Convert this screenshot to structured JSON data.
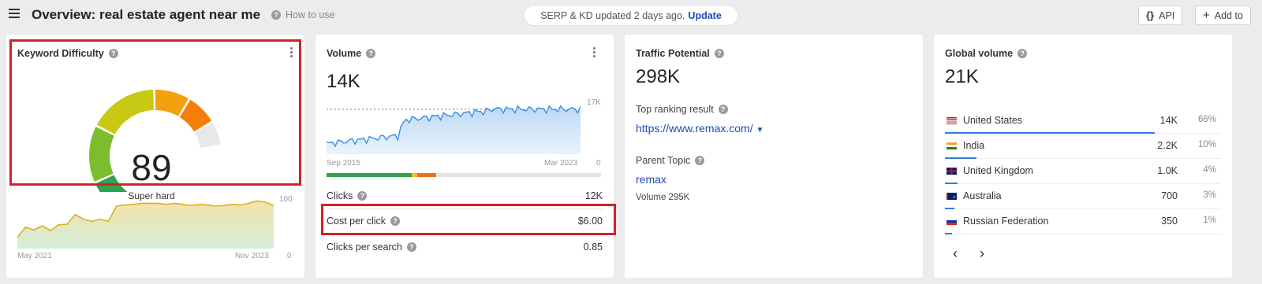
{
  "header": {
    "title": "Overview: real estate agent near me",
    "how_to_use": "How to use",
    "update_text": "SERP & KD updated 2 days ago.",
    "update_link": "Update",
    "api_label": "API",
    "api_icon": "{}",
    "add_label": "Add to",
    "add_icon": "+"
  },
  "kd": {
    "title": "Keyword Difficulty",
    "value": "89",
    "label": "Super hard",
    "gauge_value": 89,
    "trend": {
      "x_start": "May 2021",
      "x_end": "Nov 2023",
      "y_max": "100",
      "y_min": "0"
    }
  },
  "volume": {
    "title": "Volume",
    "value": "14K",
    "chart": {
      "x_start": "Sep 2015",
      "x_end": "Mar 2023",
      "y_max": "17K",
      "y_min": "0"
    },
    "intent_bar": [
      {
        "fraction": 0.31,
        "color": "#2ea24f"
      },
      {
        "fraction": 0.02,
        "color": "#f1c40f"
      },
      {
        "fraction": 0.07,
        "color": "#f26b21"
      },
      {
        "fraction": 0.6,
        "color": "#e4e4e4"
      }
    ],
    "metrics": [
      {
        "label": "Clicks",
        "value": "12K"
      },
      {
        "label": "Cost per click",
        "value": "$6.00"
      },
      {
        "label": "Clicks per search",
        "value": "0.85"
      }
    ]
  },
  "traffic": {
    "title": "Traffic Potential",
    "value": "298K",
    "top_result_label": "Top ranking result",
    "top_result_url": "https://www.remax.com/",
    "parent_topic_label": "Parent Topic",
    "parent_topic": "remax",
    "parent_volume": "Volume 295K"
  },
  "global": {
    "title": "Global volume",
    "value": "21K",
    "countries": [
      {
        "name": "United States",
        "volume": "14K",
        "pct": "66%",
        "share": 0.66,
        "flag": "us"
      },
      {
        "name": "India",
        "volume": "2.2K",
        "pct": "10%",
        "share": 0.1,
        "flag": "in"
      },
      {
        "name": "United Kingdom",
        "volume": "1.0K",
        "pct": "4%",
        "share": 0.04,
        "flag": "gb"
      },
      {
        "name": "Australia",
        "volume": "700",
        "pct": "3%",
        "share": 0.03,
        "flag": "au"
      },
      {
        "name": "Russian Federation",
        "volume": "350",
        "pct": "1%",
        "share": 0.01,
        "flag": "ru"
      }
    ],
    "prev_icon": "‹",
    "next_icon": "›"
  },
  "colors": {
    "accent": "#1d4ab8",
    "highlight": "#d61f26",
    "chart_line": "#3b8de0",
    "gauge": [
      "#2ea24f",
      "#7cbd2e",
      "#c7c914",
      "#f2a20f",
      "#f57f0a",
      "#e8e8e8"
    ]
  }
}
